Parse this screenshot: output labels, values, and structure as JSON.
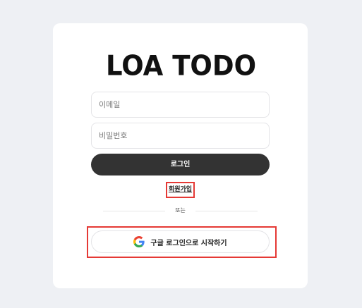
{
  "app": {
    "logo_text": "LOA TODO"
  },
  "form": {
    "email_placeholder": "이메일",
    "password_placeholder": "비밀번호",
    "login_label": "로그인",
    "signup_label": "회원가입",
    "or_label": "또는",
    "google_label": "구글 로그인으로 시작하기"
  },
  "icons": {
    "google": "google-icon"
  },
  "colors": {
    "background": "#eef0f4",
    "card": "#ffffff",
    "primary_button": "#333333",
    "highlight": "#e53935"
  }
}
